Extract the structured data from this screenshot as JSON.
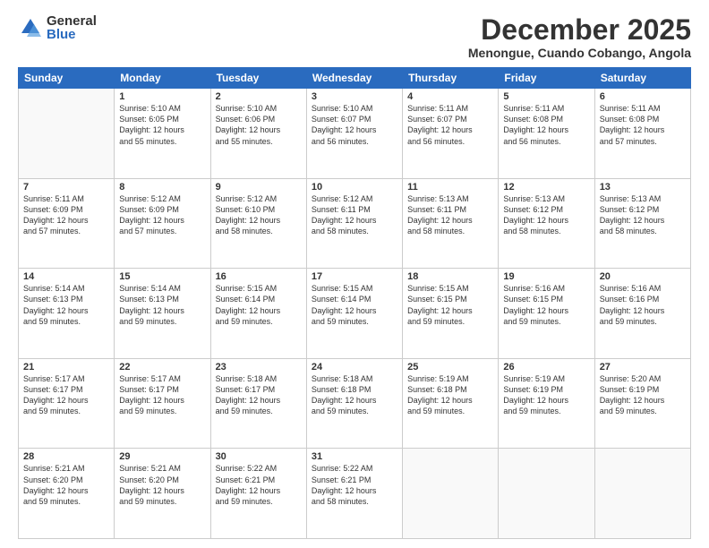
{
  "logo": {
    "general": "General",
    "blue": "Blue"
  },
  "title": "December 2025",
  "location": "Menongue, Cuando Cobango, Angola",
  "days": [
    "Sunday",
    "Monday",
    "Tuesday",
    "Wednesday",
    "Thursday",
    "Friday",
    "Saturday"
  ],
  "weeks": [
    [
      {
        "day": "",
        "info": ""
      },
      {
        "day": "1",
        "info": "Sunrise: 5:10 AM\nSunset: 6:05 PM\nDaylight: 12 hours\nand 55 minutes."
      },
      {
        "day": "2",
        "info": "Sunrise: 5:10 AM\nSunset: 6:06 PM\nDaylight: 12 hours\nand 55 minutes."
      },
      {
        "day": "3",
        "info": "Sunrise: 5:10 AM\nSunset: 6:07 PM\nDaylight: 12 hours\nand 56 minutes."
      },
      {
        "day": "4",
        "info": "Sunrise: 5:11 AM\nSunset: 6:07 PM\nDaylight: 12 hours\nand 56 minutes."
      },
      {
        "day": "5",
        "info": "Sunrise: 5:11 AM\nSunset: 6:08 PM\nDaylight: 12 hours\nand 56 minutes."
      },
      {
        "day": "6",
        "info": "Sunrise: 5:11 AM\nSunset: 6:08 PM\nDaylight: 12 hours\nand 57 minutes."
      }
    ],
    [
      {
        "day": "7",
        "info": "Sunrise: 5:11 AM\nSunset: 6:09 PM\nDaylight: 12 hours\nand 57 minutes."
      },
      {
        "day": "8",
        "info": "Sunrise: 5:12 AM\nSunset: 6:09 PM\nDaylight: 12 hours\nand 57 minutes."
      },
      {
        "day": "9",
        "info": "Sunrise: 5:12 AM\nSunset: 6:10 PM\nDaylight: 12 hours\nand 58 minutes."
      },
      {
        "day": "10",
        "info": "Sunrise: 5:12 AM\nSunset: 6:11 PM\nDaylight: 12 hours\nand 58 minutes."
      },
      {
        "day": "11",
        "info": "Sunrise: 5:13 AM\nSunset: 6:11 PM\nDaylight: 12 hours\nand 58 minutes."
      },
      {
        "day": "12",
        "info": "Sunrise: 5:13 AM\nSunset: 6:12 PM\nDaylight: 12 hours\nand 58 minutes."
      },
      {
        "day": "13",
        "info": "Sunrise: 5:13 AM\nSunset: 6:12 PM\nDaylight: 12 hours\nand 58 minutes."
      }
    ],
    [
      {
        "day": "14",
        "info": "Sunrise: 5:14 AM\nSunset: 6:13 PM\nDaylight: 12 hours\nand 59 minutes."
      },
      {
        "day": "15",
        "info": "Sunrise: 5:14 AM\nSunset: 6:13 PM\nDaylight: 12 hours\nand 59 minutes."
      },
      {
        "day": "16",
        "info": "Sunrise: 5:15 AM\nSunset: 6:14 PM\nDaylight: 12 hours\nand 59 minutes."
      },
      {
        "day": "17",
        "info": "Sunrise: 5:15 AM\nSunset: 6:14 PM\nDaylight: 12 hours\nand 59 minutes."
      },
      {
        "day": "18",
        "info": "Sunrise: 5:15 AM\nSunset: 6:15 PM\nDaylight: 12 hours\nand 59 minutes."
      },
      {
        "day": "19",
        "info": "Sunrise: 5:16 AM\nSunset: 6:15 PM\nDaylight: 12 hours\nand 59 minutes."
      },
      {
        "day": "20",
        "info": "Sunrise: 5:16 AM\nSunset: 6:16 PM\nDaylight: 12 hours\nand 59 minutes."
      }
    ],
    [
      {
        "day": "21",
        "info": "Sunrise: 5:17 AM\nSunset: 6:17 PM\nDaylight: 12 hours\nand 59 minutes."
      },
      {
        "day": "22",
        "info": "Sunrise: 5:17 AM\nSunset: 6:17 PM\nDaylight: 12 hours\nand 59 minutes."
      },
      {
        "day": "23",
        "info": "Sunrise: 5:18 AM\nSunset: 6:17 PM\nDaylight: 12 hours\nand 59 minutes."
      },
      {
        "day": "24",
        "info": "Sunrise: 5:18 AM\nSunset: 6:18 PM\nDaylight: 12 hours\nand 59 minutes."
      },
      {
        "day": "25",
        "info": "Sunrise: 5:19 AM\nSunset: 6:18 PM\nDaylight: 12 hours\nand 59 minutes."
      },
      {
        "day": "26",
        "info": "Sunrise: 5:19 AM\nSunset: 6:19 PM\nDaylight: 12 hours\nand 59 minutes."
      },
      {
        "day": "27",
        "info": "Sunrise: 5:20 AM\nSunset: 6:19 PM\nDaylight: 12 hours\nand 59 minutes."
      }
    ],
    [
      {
        "day": "28",
        "info": "Sunrise: 5:21 AM\nSunset: 6:20 PM\nDaylight: 12 hours\nand 59 minutes."
      },
      {
        "day": "29",
        "info": "Sunrise: 5:21 AM\nSunset: 6:20 PM\nDaylight: 12 hours\nand 59 minutes."
      },
      {
        "day": "30",
        "info": "Sunrise: 5:22 AM\nSunset: 6:21 PM\nDaylight: 12 hours\nand 59 minutes."
      },
      {
        "day": "31",
        "info": "Sunrise: 5:22 AM\nSunset: 6:21 PM\nDaylight: 12 hours\nand 58 minutes."
      },
      {
        "day": "",
        "info": ""
      },
      {
        "day": "",
        "info": ""
      },
      {
        "day": "",
        "info": ""
      }
    ]
  ]
}
